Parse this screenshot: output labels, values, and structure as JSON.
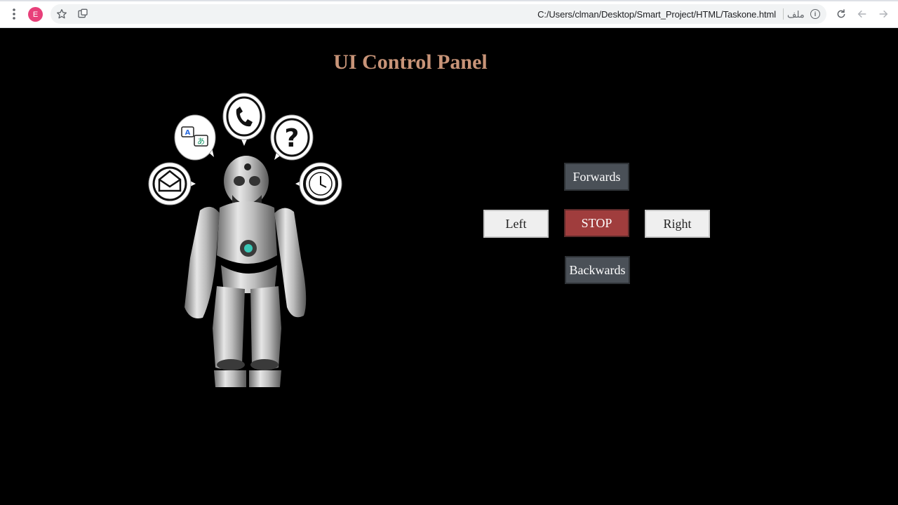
{
  "browser": {
    "profile_initial": "E",
    "url": "C:/Users/clman/Desktop/Smart_Project/HTML/Taskone.html",
    "scheme_label": "ملف",
    "info_symbol": "i"
  },
  "page": {
    "title": "UI Control Panel"
  },
  "controls": {
    "forwards": "Forwards",
    "left": "Left",
    "stop": "STOP",
    "right": "Right",
    "backwards": "Backwards"
  },
  "robot_bubbles": {
    "translate_a": "A",
    "translate_b": "あ",
    "help": "?"
  },
  "colors": {
    "title": "#c89478",
    "stop": "#a03d3d",
    "dark_button": "#4a5057",
    "light_button": "#efefef"
  },
  "icons": [
    "menu-dots-icon",
    "profile-avatar",
    "star-icon",
    "extension-icon",
    "info-icon",
    "reload-icon",
    "back-arrow-icon",
    "forward-arrow-icon",
    "envelope-icon",
    "translate-icon",
    "phone-icon",
    "question-icon",
    "clock-icon"
  ]
}
